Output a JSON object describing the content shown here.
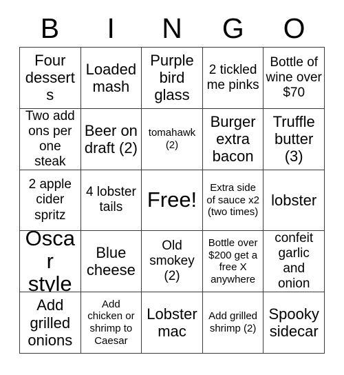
{
  "card": {
    "title": "BINGO",
    "header_letters": [
      "B",
      "I",
      "N",
      "G",
      "O"
    ],
    "grid_size": "5x5",
    "border_color": "#3a3a3a",
    "background_color": "#ffffff",
    "text_color": "#000000",
    "free_space": {
      "label": "Free!",
      "row": 3,
      "column": 3
    },
    "columns": [
      {
        "letter": "B",
        "cells": [
          {
            "text": "Four desserts",
            "size": "lg"
          },
          {
            "text": "Two add ons per one steak",
            "size": "md"
          },
          {
            "text": "2 apple cider spritz",
            "size": "md"
          },
          {
            "text": "Oscar style",
            "size": "xl"
          },
          {
            "text": "Add grilled onions",
            "size": "lg"
          }
        ]
      },
      {
        "letter": "I",
        "cells": [
          {
            "text": "Loaded mash",
            "size": "lg"
          },
          {
            "text": "Beer on draft (2)",
            "size": "lg"
          },
          {
            "text": "4 lobster tails",
            "size": "md"
          },
          {
            "text": "Blue cheese",
            "size": "lg"
          },
          {
            "text": "Add chicken or shrimp to Caesar",
            "size": "sm"
          }
        ]
      },
      {
        "letter": "N",
        "cells": [
          {
            "text": "Purple bird glass",
            "size": "lg"
          },
          {
            "text": "tomahawk (2)",
            "size": "sm"
          },
          {
            "text": "Free!",
            "size": "xl"
          },
          {
            "text": "Old smokey (2)",
            "size": "md"
          },
          {
            "text": "Lobster mac",
            "size": "lg"
          }
        ]
      },
      {
        "letter": "G",
        "cells": [
          {
            "text": "2 tickled me pinks",
            "size": "md"
          },
          {
            "text": "Burger extra bacon",
            "size": "lg"
          },
          {
            "text": "Extra side of sauce x2 (two times)",
            "size": "sm"
          },
          {
            "text": "Bottle over $200 get a free X anywhere",
            "size": "sm"
          },
          {
            "text": "Add grilled shrimp (2)",
            "size": "sm"
          }
        ]
      },
      {
        "letter": "O",
        "cells": [
          {
            "text": "Bottle of wine over $70",
            "size": "md"
          },
          {
            "text": "Truffle butter (3)",
            "size": "lg"
          },
          {
            "text": "lobster",
            "size": "lg"
          },
          {
            "text": "confeit garlic and onion",
            "size": "md"
          },
          {
            "text": "Spooky sidecar",
            "size": "lg"
          }
        ]
      }
    ],
    "rows": [
      [
        "Four desserts",
        "Loaded mash",
        "Purple bird glass",
        "2 tickled me pinks",
        "Bottle of wine over $70"
      ],
      [
        "Two add ons per one steak",
        "Beer on draft (2)",
        "tomahawk (2)",
        "Burger extra bacon",
        "Truffle butter (3)"
      ],
      [
        "2 apple cider spritz",
        "4 lobster tails",
        "Free!",
        "Extra side of sauce x2 (two times)",
        "lobster"
      ],
      [
        "Oscar style",
        "Blue cheese",
        "Old smokey (2)",
        "Bottle over $200 get a free X anywhere",
        "confeit garlic and onion"
      ],
      [
        "Add grilled onions",
        "Add chicken or shrimp to Caesar",
        "Lobster mac",
        "Add grilled shrimp (2)",
        "Spooky sidecar"
      ]
    ],
    "row_sizes": [
      [
        "lg",
        "lg",
        "lg",
        "md",
        "md"
      ],
      [
        "md",
        "lg",
        "sm",
        "lg",
        "lg"
      ],
      [
        "md",
        "md",
        "xl",
        "sm",
        "lg"
      ],
      [
        "xl",
        "lg",
        "md",
        "sm",
        "md"
      ],
      [
        "lg",
        "sm",
        "lg",
        "sm",
        "lg"
      ]
    ]
  }
}
